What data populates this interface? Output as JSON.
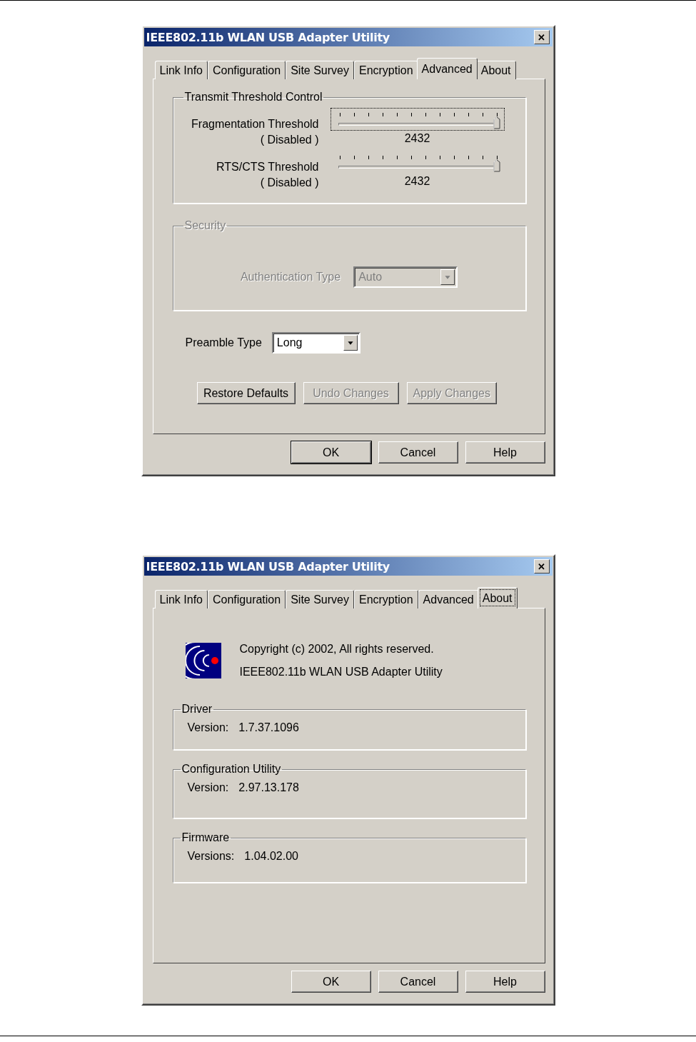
{
  "dialogs": [
    {
      "title": "IEEE802.11b WLAN USB Adapter Utility",
      "close": "✕",
      "tabs": [
        {
          "label": "Link Info",
          "selected": false
        },
        {
          "label": "Configuration",
          "selected": false
        },
        {
          "label": "Site Survey",
          "selected": false
        },
        {
          "label": "Encryption",
          "selected": false
        },
        {
          "label": "Advanced",
          "selected": true
        },
        {
          "label": "About",
          "selected": false
        }
      ],
      "content": {
        "kind": "advanced",
        "threshold_group": {
          "title": "Transmit Threshold Control",
          "sliders": [
            {
              "label": "Fragmentation Threshold",
              "note": "( Disabled )",
              "level": 1,
              "reading": "2432",
              "focused": true
            },
            {
              "label": "RTS/CTS Threshold",
              "note": "( Disabled )",
              "level": 1,
              "reading": "2432",
              "focused": false
            }
          ]
        },
        "security_group": {
          "title": "Security",
          "disabled": true,
          "label": "Authentication Type",
          "value": "Auto"
        },
        "preamble": {
          "label": "Preamble Type",
          "value": "Long"
        },
        "actions": [
          {
            "label": "Restore Defaults",
            "disabled": false
          },
          {
            "label": "Undo Changes",
            "disabled": true
          },
          {
            "label": "Apply Changes",
            "disabled": true
          }
        ]
      },
      "buttons": [
        {
          "label": "OK",
          "default": true
        },
        {
          "label": "Cancel",
          "default": false
        },
        {
          "label": "Help",
          "default": false
        }
      ]
    },
    {
      "title": "IEEE802.11b WLAN USB Adapter Utility",
      "close": "✕",
      "tabs": [
        {
          "label": "Link Info",
          "selected": false
        },
        {
          "label": "Configuration",
          "selected": false
        },
        {
          "label": "Site Survey",
          "selected": false
        },
        {
          "label": "Encryption",
          "selected": false
        },
        {
          "label": "Advanced",
          "selected": false
        },
        {
          "label": "About",
          "selected": true
        }
      ],
      "content": {
        "kind": "about",
        "lines": [
          "Copyright (c) 2002, All rights reserved.",
          "IEEE802.11b WLAN USB Adapter Utility"
        ],
        "sections": [
          {
            "title": "Driver",
            "label": "Version:",
            "value": "1.7.37.1096"
          },
          {
            "title": "Configuration Utility",
            "label": "Version:",
            "value": "2.97.13.178"
          },
          {
            "title": "Firmware",
            "label": "Versions:",
            "value": "1.04.02.00"
          }
        ]
      },
      "buttons": [
        {
          "label": "OK",
          "default": false
        },
        {
          "label": "Cancel",
          "default": false
        },
        {
          "label": "Help",
          "default": false
        }
      ]
    }
  ]
}
